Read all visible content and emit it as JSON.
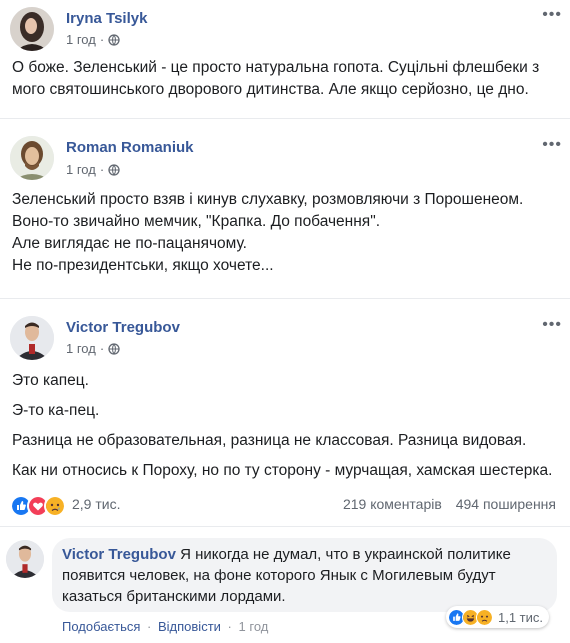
{
  "posts": [
    {
      "author": "Iryna Tsilyk",
      "time": "1 год",
      "privacy_icon": "globe-icon",
      "lines": [
        "О боже. Зеленський - це просто натуральна гопота. Суцільні флешбеки з",
        "мого святошинського дворового дитинства. Але якщо серйозно, це дно."
      ]
    },
    {
      "author": "Roman Romaniuk",
      "time": "1 год",
      "privacy_icon": "globe-icon",
      "lines": [
        "Зеленський просто взяв і кинув слухавку, розмовляючи з Порошенеом.",
        "Воно-то звичайно мемчик, \"Крапка. До побачення\".",
        "Але виглядає не по-пацанячому.",
        "Не по-президентськи, якщо хочете..."
      ]
    },
    {
      "author": "Victor Tregubov",
      "time": "1 год",
      "privacy_icon": "globe-icon",
      "paragraphs": [
        "Это капец.",
        "Э-то ка-пец.",
        "Разница не образовательная, разница не классовая. Разница видовая.",
        "Как ни относись к Пороху, но по ту сторону - мурчащая, хамская шестерка."
      ]
    }
  ],
  "stats": {
    "reactions": [
      "like-icon",
      "love-icon",
      "sad-icon"
    ],
    "reaction_count": "2,9 тис.",
    "comments": "219 коментарів",
    "shares": "494 поширення"
  },
  "comment": {
    "author": "Victor Tregubov",
    "text": "Я никогда не думал, что в украинской политике появится человек, на фоне которого Янык с Могилевым будут казаться британскими лордами.",
    "reactions": [
      "like-icon",
      "haha-icon",
      "sad-icon"
    ],
    "reaction_count": "1,1 тис.",
    "like_label": "Подобається",
    "reply_label": "Відповісти",
    "time": "1 год"
  },
  "colors": {
    "link": "#385898",
    "meta": "#616770",
    "like": "#1877f2",
    "love": "#f33e58",
    "sad": "#f7b125"
  }
}
